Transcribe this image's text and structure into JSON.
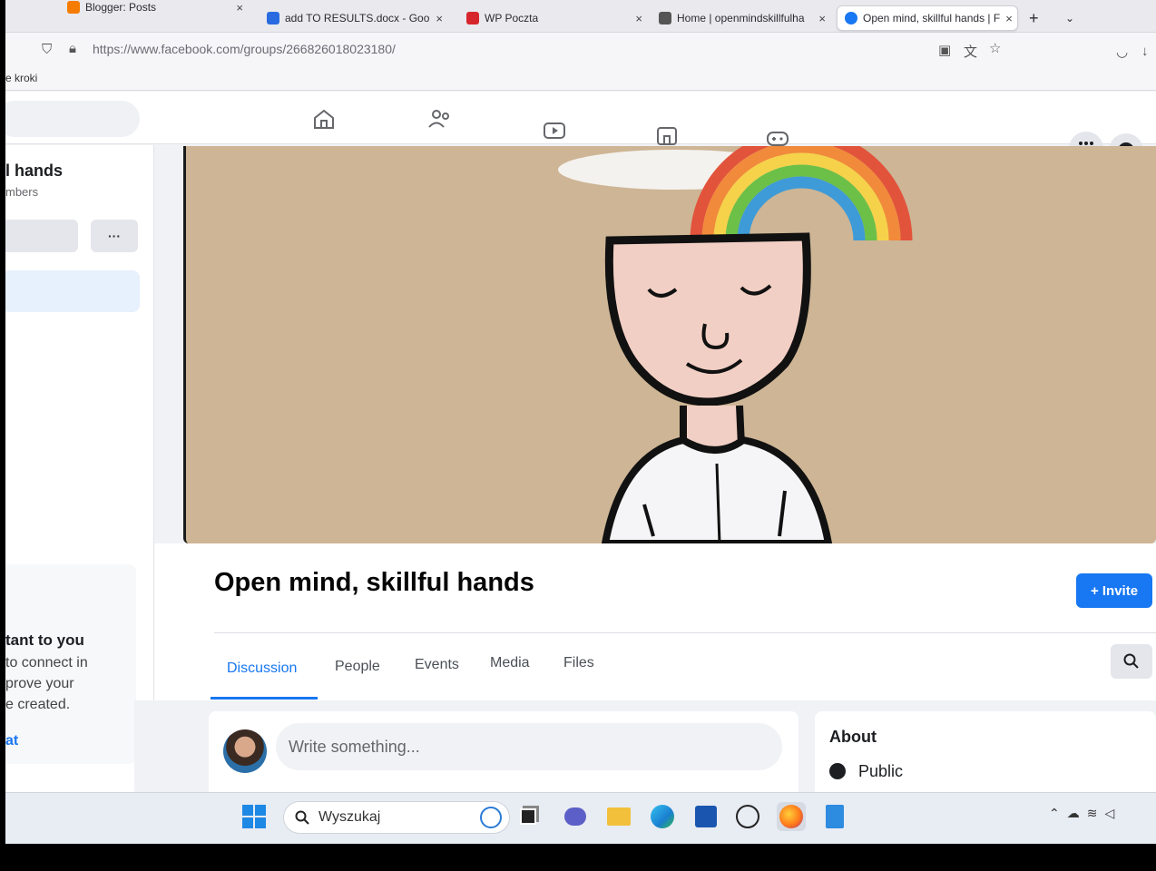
{
  "browser": {
    "tabs": [
      {
        "label": "Blogger: Posts",
        "close": "×"
      },
      {
        "label": "add TO RESULTS.docx - Goo",
        "close": "×"
      },
      {
        "label": "WP Poczta",
        "close": "×"
      },
      {
        "label": "Home | openmindskillfulha",
        "close": "×"
      },
      {
        "label": "Open mind, skillful hands | F",
        "close": "×"
      }
    ],
    "new_tab": "+",
    "url": "https://www.facebook.com/groups/266826018023180/",
    "bookmark": "e kroki"
  },
  "sidebar": {
    "group_name": "l hands",
    "members": "mbers",
    "more": "···",
    "card_title": "tant to you",
    "card_lines": [
      "to connect in",
      "prove your",
      "e created."
    ],
    "card_link": "at"
  },
  "group": {
    "title": "Open mind, skillful hands",
    "invite_label": "+ Invite",
    "tabs": [
      "Discussion",
      "People",
      "Events",
      "Media",
      "Files"
    ],
    "active_tab": "Discussion",
    "composer_placeholder": "Write something..."
  },
  "about": {
    "heading": "About",
    "privacy": "Public"
  },
  "taskbar": {
    "search_label": "Wyszukaj"
  },
  "colors": {
    "fb_blue": "#1877f2",
    "cover_bg": "#cdb595"
  }
}
